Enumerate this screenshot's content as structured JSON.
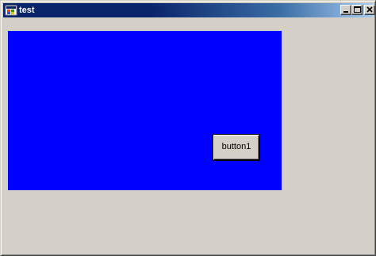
{
  "window": {
    "title": "test",
    "app_icon": "app-window-icon",
    "controls": {
      "minimize_icon": "minimize-icon",
      "maximize_icon": "maximize-icon",
      "close_icon": "close-icon"
    }
  },
  "form": {
    "panel_color": "#0000ff",
    "button1_label": "button1"
  },
  "colors": {
    "titlebar_start": "#0a246a",
    "titlebar_end": "#a6caf0",
    "face": "#d4d0c8"
  }
}
